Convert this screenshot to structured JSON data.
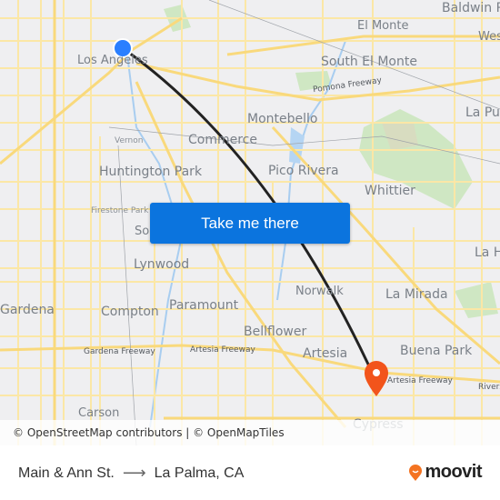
{
  "map": {
    "labels": {
      "los_angeles": "Los Angeles",
      "el_monte": "El Monte",
      "baldwin_park": "Baldwin P",
      "west_covina": "Wes",
      "south_el_monte": "South El Monte",
      "pomona_freeway": "Pomona Freeway",
      "montebello": "Montebello",
      "la_puente": "La Pue",
      "vernon": "Vernon",
      "commerce": "Commerce",
      "huntington_park": "Huntington Park",
      "pico_rivera": "Pico Rivera",
      "whittier": "Whittier",
      "firestone_park": "Firestone Park",
      "south_gate": "Sou",
      "la_habra": "La H",
      "lynwood": "Lynwood",
      "norwalk": "Norwalk",
      "la_mirada": "La Mirada",
      "gardena": "Gardena",
      "compton": "Compton",
      "paramount": "Paramount",
      "bellflower": "Bellflower",
      "artesia": "Artesia",
      "buena_park": "Buena Park",
      "gardena_freeway": "Gardena Freeway",
      "artesia_freeway": "Artesia Freeway",
      "artesia_freeway_2": "Artesia Freeway",
      "riverside": "Rivers",
      "carson": "Carson",
      "cypress": "Cypress"
    },
    "origin_marker_color": "#2a7fff",
    "destination_marker_color": "#f2541b",
    "route_color": "#222222",
    "attribution": "© OpenStreetMap contributors | © OpenMapTiles"
  },
  "cta": {
    "label": "Take me there",
    "color": "#0b74de"
  },
  "footer": {
    "origin": "Main & Ann St.",
    "arrow": "⟶",
    "destination": "La Palma, CA",
    "brand": "moovit",
    "brand_color": "#f47321"
  }
}
